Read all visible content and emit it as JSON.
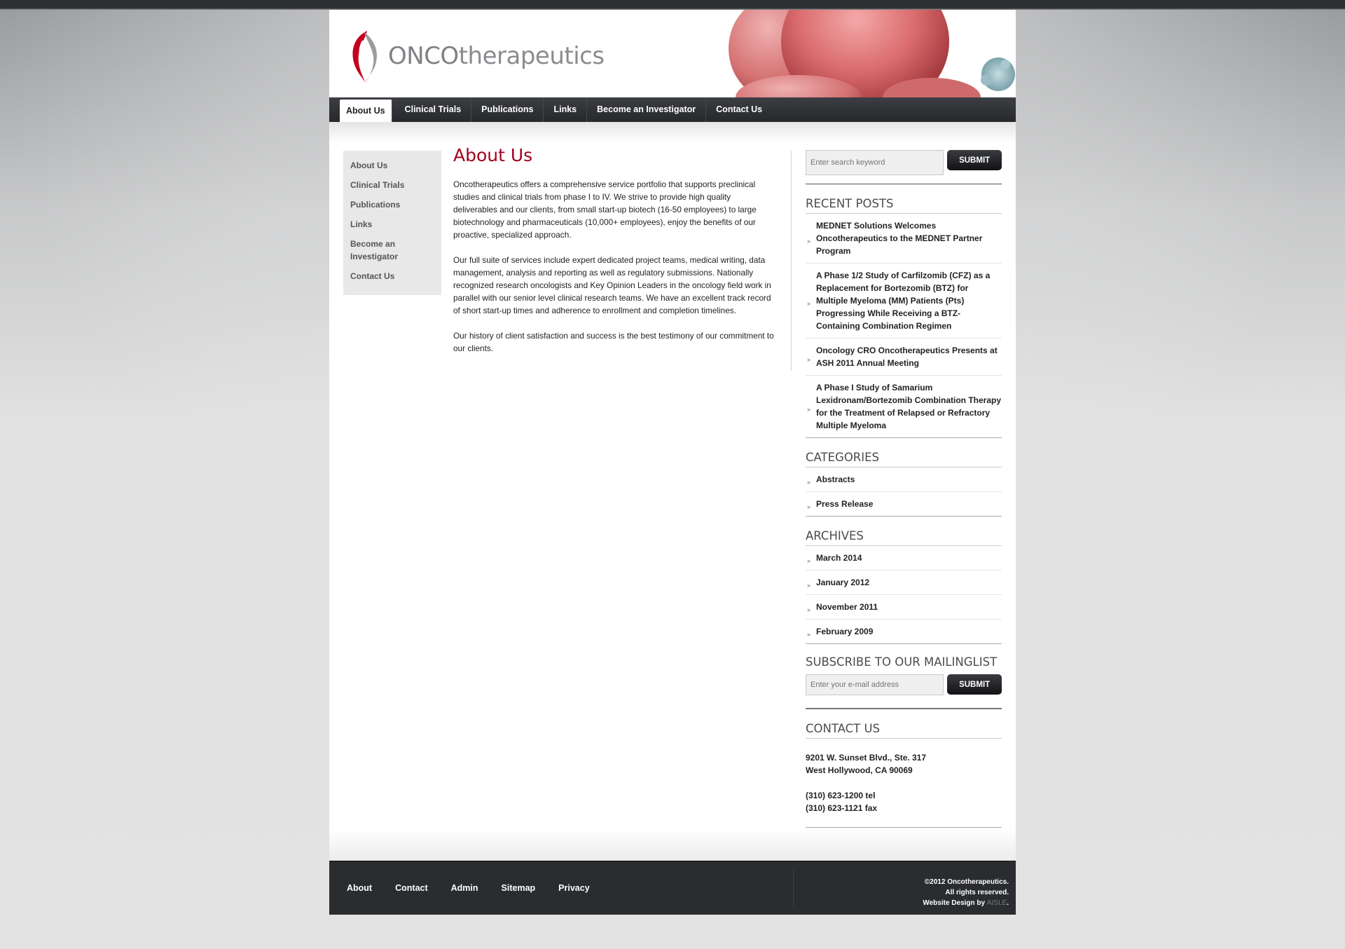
{
  "brand": {
    "name_part1": "ONCO",
    "name_part2": "therapeutics"
  },
  "nav": {
    "items": [
      {
        "label": "About Us",
        "active": true
      },
      {
        "label": "Clinical Trials"
      },
      {
        "label": "Publications"
      },
      {
        "label": "Links"
      },
      {
        "label": "Become an Investigator"
      },
      {
        "label": "Contact Us"
      }
    ]
  },
  "subnav": {
    "items": [
      {
        "label": "About Us"
      },
      {
        "label": "Clinical Trials"
      },
      {
        "label": "Publications"
      },
      {
        "label": "Links"
      },
      {
        "label": "Become an Investigator"
      },
      {
        "label": "Contact Us"
      }
    ]
  },
  "content": {
    "title": "About Us",
    "paragraphs": [
      "Oncotherapeutics offers a comprehensive service portfolio that supports preclinical studies and clinical trials from phase I to IV. We strive to provide high quality deliverables and our clients, from small start-up biotech (16-50 employees) to large biotechnology and pharmaceuticals (10,000+ employees), enjoy the benefits of our proactive, specialized approach.",
      "Our full suite of services include expert dedicated project teams, medical writing, data management, analysis and reporting as well as regulatory submissions. Nationally recognized research oncologists and Key Opinion Leaders in the oncology field work in parallel with our senior level clinical research teams. We have an excellent track record of short start-up times and adherence to enrollment and completion timelines.",
      "Our history of client satisfaction and success is the best testimony of our commitment to our clients."
    ]
  },
  "sidebar": {
    "search": {
      "placeholder": "Enter search keyword",
      "button": "SUBMIT"
    },
    "recent_posts": {
      "title": "RECENT POSTS",
      "items": [
        "MEDNET Solutions Welcomes Oncotherapeutics to the MEDNET Partner Program",
        "A Phase 1/2 Study of Carfilzomib (CFZ) as a Replacement for Bortezomib (BTZ) for Multiple Myeloma (MM) Patients (Pts) Progressing While Receiving a BTZ-Containing Combination Regimen",
        "Oncology CRO Oncotherapeutics Presents at ASH 2011 Annual Meeting",
        "A Phase I Study of Samarium Lexidronam/Bortezomib Combination Therapy for the Treatment of Relapsed or Refractory Multiple Myeloma"
      ]
    },
    "categories": {
      "title": "CATEGORIES",
      "items": [
        "Abstracts",
        "Press Release"
      ]
    },
    "archives": {
      "title": "ARCHIVES",
      "items": [
        "March 2014",
        "January 2012",
        "November 2011",
        "February 2009"
      ]
    },
    "mailing": {
      "title": "SUBSCRIBE TO OUR MAILINGLIST",
      "placeholder": "Enter your e-mail address",
      "button": "SUBMIT"
    },
    "contact": {
      "title": "CONTACT US",
      "address1": "9201 W. Sunset Blvd., Ste. 317",
      "address2": "West Hollywood, CA 90069",
      "tel": "(310) 623-1200 tel",
      "fax": "(310) 623-1121 fax"
    }
  },
  "footer": {
    "links": [
      "About",
      "Contact",
      "Admin",
      "Sitemap",
      "Privacy"
    ],
    "copyright": "©2012 Oncotherapeutics.",
    "rights": "All rights reserved.",
    "design_prefix": "Website Design by ",
    "design_by": "AISLE",
    "design_suffix": "."
  },
  "colors": {
    "accent_red": "#a3001d",
    "nav_dark": "#2a2c30"
  }
}
